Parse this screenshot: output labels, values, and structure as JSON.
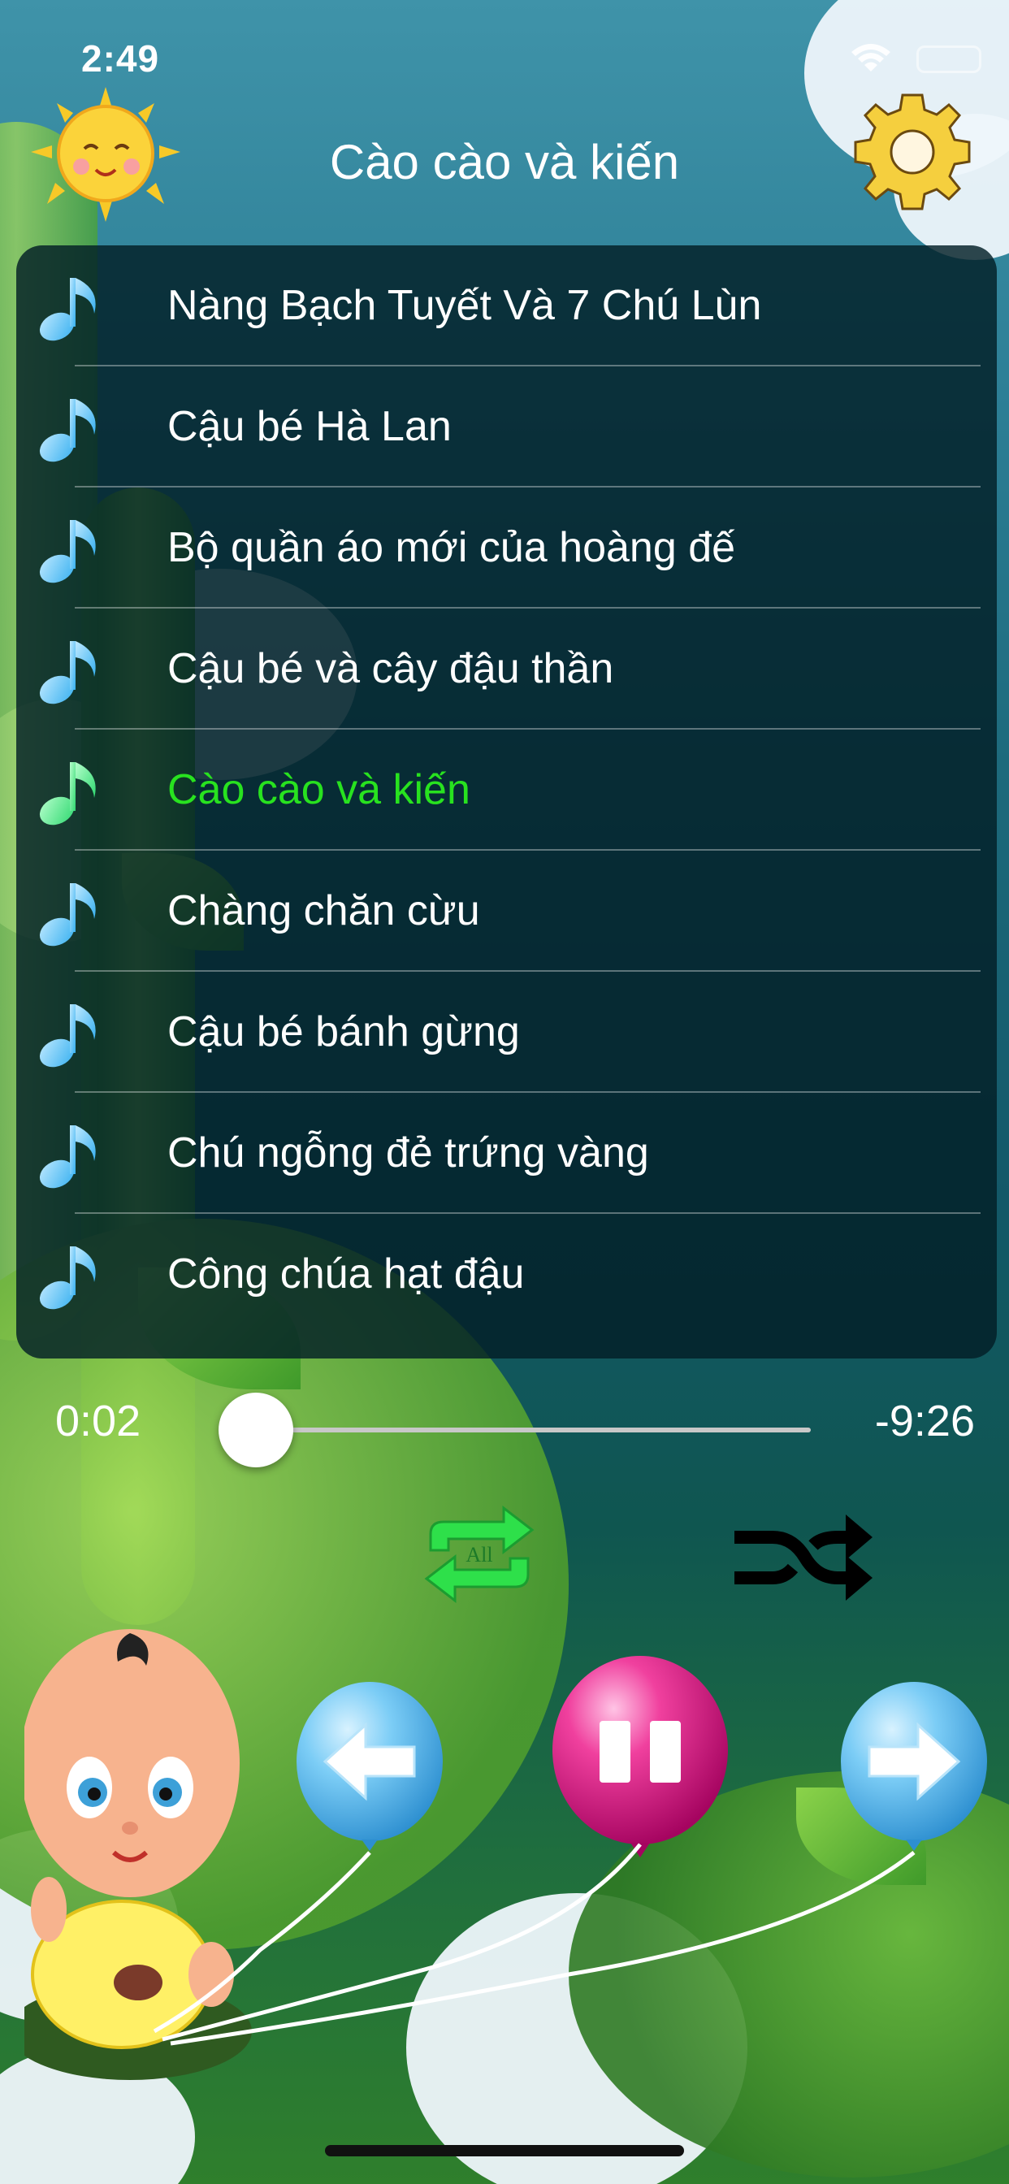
{
  "status_bar": {
    "time": "2:49"
  },
  "header": {
    "title": "Cào cào và kiến",
    "left_icon": "sun-icon",
    "right_icon": "gear-icon"
  },
  "playlist": {
    "items": [
      {
        "label": "Nàng Bạch Tuyết Và 7 Chú Lùn"
      },
      {
        "label": "Cậu bé Hà Lan"
      },
      {
        "label": "Bộ quần áo mới của hoàng đế"
      },
      {
        "label": "Cậu bé và cây đậu thần"
      },
      {
        "label": "Cào cào và kiến"
      },
      {
        "label": "Chàng chăn cừu"
      },
      {
        "label": "Cậu bé bánh gừng"
      },
      {
        "label": "Chú ngỗng đẻ trứng vàng"
      },
      {
        "label": "Công chúa hạt đậu"
      }
    ],
    "active_index": 4
  },
  "player": {
    "elapsed": "0:02",
    "remaining": "-9:26",
    "progress": 0.0035,
    "repeat_label": "All",
    "repeat_active": true,
    "shuffle_active": false
  },
  "colors": {
    "active_text": "#28e21f",
    "repeat_icon": "#2ee04a",
    "play_balloon": "#e8118c",
    "nav_balloon": "#6cc8f5"
  }
}
